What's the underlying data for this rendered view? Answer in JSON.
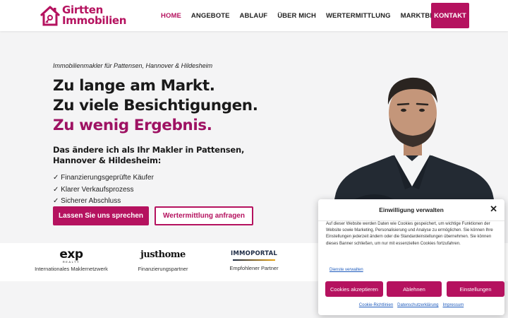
{
  "brand": {
    "line1": "Girtten",
    "line2": "Immobilien",
    "color": "#b5125f"
  },
  "nav": {
    "items": [
      {
        "label": "HOME",
        "active": true
      },
      {
        "label": "ANGEBOTE"
      },
      {
        "label": "ABLAUF"
      },
      {
        "label": "ÜBER MICH"
      },
      {
        "label": "WERTERMITTLUNG"
      },
      {
        "label": "MARKTBERICHTE"
      }
    ],
    "cta": "KONTAKT"
  },
  "hero": {
    "tagline": "Immobilienmakler für Pattensen, Hannover & Hildesheim",
    "headline_1": "Zu lange am Markt.",
    "headline_2": "Zu viele Besichtigungen.",
    "headline_3": "Zu wenig Ergebnis.",
    "subhead": "Das ändere ich als Ihr Makler in Pattensen, Hannover & Hildesheim:",
    "checks": [
      "✓ Finanzierungsgeprüfte Käufer",
      "✓ Klarer Verkaufsprozess",
      "✓ Sicherer Abschluss"
    ],
    "primary_button": "Lassen Sie uns sprechen",
    "secondary_button": "Wertermittlung anfragen"
  },
  "partners": [
    {
      "logo": "exp",
      "logo_sub": "REALTY",
      "label": "Internationales Maklernetzwerk"
    },
    {
      "logo": "justhome",
      "label": "Finanzierungspartner"
    },
    {
      "logo": "IMMOPORTAL",
      "label": "Empfohlener Partner"
    }
  ],
  "cookie": {
    "title": "Einwilligung verwalten",
    "text": "Auf dieser Website werden Daten wie Cookies gespeichert, um wichtige Funktionen der Website sowie Marketing, Personalisierung und Analyse zu ermöglichen. Sie können Ihre Einstellungen jederzeit ändern oder die Standardeinstellungen übernehmen. Sie können dieses Banner schließen, um nur mit essenziellen Cookies fortzufahren.",
    "vendors_link": "Dienste verwalten",
    "accept": "Cookies akzeptieren",
    "deny": "Ablehnen",
    "settings": "Einstellungen",
    "footer": [
      "Cookie-Richtlinien",
      "Datenschutzerklärung",
      "Impressum"
    ]
  },
  "colors": {
    "accent": "#b5125f",
    "link": "#1e5bbd",
    "background": "#f4f4f5"
  }
}
